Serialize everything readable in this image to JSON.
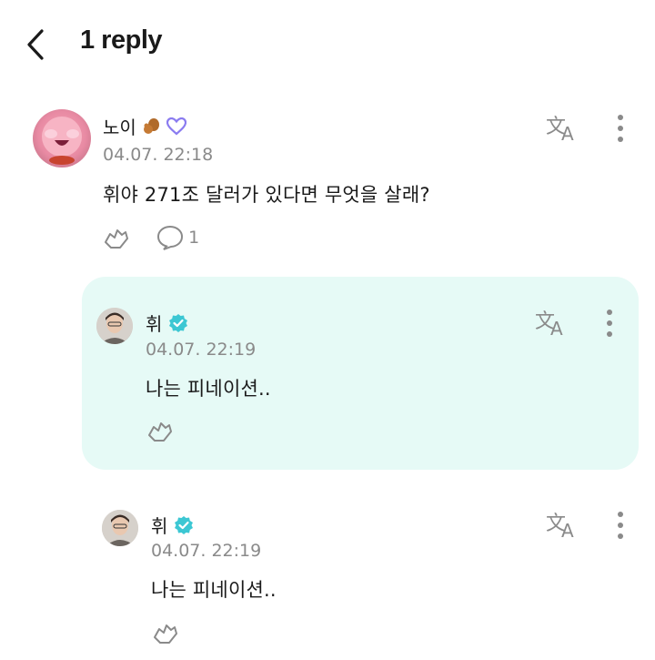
{
  "header": {
    "title": "1 reply"
  },
  "comment": {
    "username": "노이",
    "timestamp": "04.07. 22:18",
    "text": "휘야 271조 달러가 있다면 무엇을 살래?",
    "reply_count": "1"
  },
  "replies": [
    {
      "username": "휘",
      "timestamp": "04.07. 22:19",
      "text": "나는 피네이션.."
    },
    {
      "username": "휘",
      "timestamp": "04.07. 22:19",
      "text": "나는 피네이션.."
    }
  ],
  "colors": {
    "highlight_bg": "#e6faf6",
    "verified": "#3cc7d3",
    "heart_outline": "#8a7bf0"
  }
}
